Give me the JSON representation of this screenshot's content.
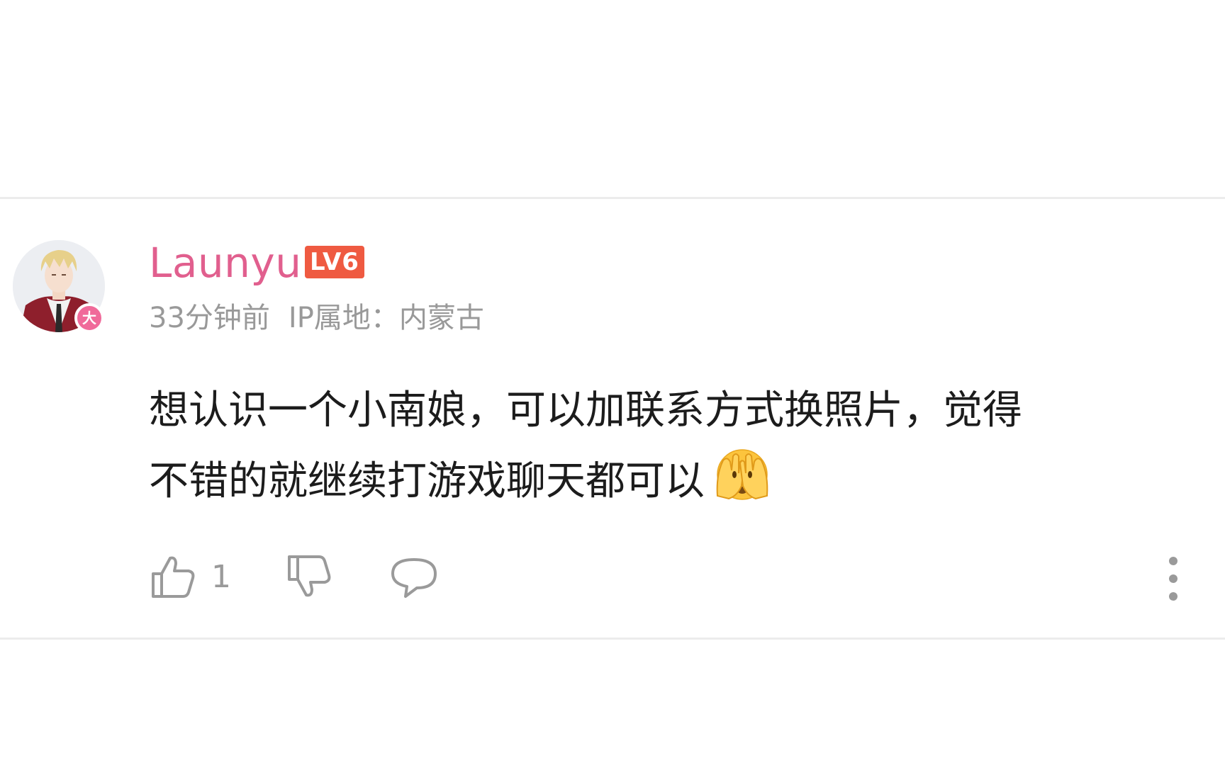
{
  "comment": {
    "username": "Launyu",
    "level": "LV6",
    "vip_badge": "大",
    "time": "33分钟前",
    "ip_location": "IP属地：内蒙古",
    "text_line1": "想认识一个小南娘，可以加联系方式换照片，觉得",
    "text_line2": "不错的就继续打游戏聊天都可以",
    "emoji": "face-with-hands-over-eyes-emoji",
    "like_count": "1"
  },
  "colors": {
    "username": "#e15f8e",
    "level_badge": "#ef5a41",
    "vip_badge": "#f06a9a",
    "meta_text": "#999999",
    "icon": "#9a9a9a"
  }
}
